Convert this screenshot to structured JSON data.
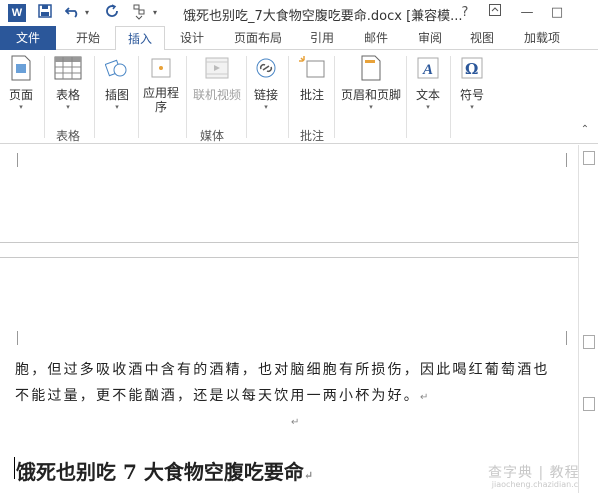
{
  "title_bar": {
    "app_icon": "W",
    "title": "饿死也别吃_7大食物空腹吃要命.docx [兼容模...",
    "help": "?",
    "ribbon_display": "⊡",
    "minimize": "—",
    "maximize": "□"
  },
  "quick_access": {
    "save_icon": "save-icon",
    "undo_icon": "undo-icon",
    "redo_icon": "redo-icon",
    "customize_icon": "customize-icon"
  },
  "tabs": [
    {
      "label": "文件"
    },
    {
      "label": "开始"
    },
    {
      "label": "插入",
      "active": true
    },
    {
      "label": "设计"
    },
    {
      "label": "页面布局"
    },
    {
      "label": "引用"
    },
    {
      "label": "邮件"
    },
    {
      "label": "审阅"
    },
    {
      "label": "视图"
    },
    {
      "label": "加载项"
    }
  ],
  "ribbon": {
    "buttons": [
      {
        "label": "页面",
        "icon": "pages-icon",
        "dropdown": true
      },
      {
        "label": "表格",
        "icon": "table-icon",
        "dropdown": true
      },
      {
        "label": "插图",
        "icon": "illustrations-icon",
        "dropdown": true
      },
      {
        "label": "应用程",
        "label2": "序",
        "icon": "apps-icon",
        "dropdown": true
      },
      {
        "label": "联机视频",
        "icon": "online-video-icon",
        "disabled": true
      },
      {
        "label": "链接",
        "icon": "link-icon",
        "dropdown": true
      },
      {
        "label": "批注",
        "icon": "comment-icon"
      },
      {
        "label": "页眉和页脚",
        "icon": "header-footer-icon",
        "dropdown": true
      },
      {
        "label": "文本",
        "icon": "text-icon",
        "dropdown": true
      },
      {
        "label": "符号",
        "icon": "symbol-icon",
        "dropdown": true
      }
    ],
    "groups": [
      "表格",
      "媒体",
      "批注"
    ]
  },
  "document": {
    "line1": "胞，但过多吸收酒中含有的酒精，也对脑细胞有所损伤，因此喝红葡萄酒也",
    "line2": "不能过量，更不能酗酒，还是以每天饮用一两小杯为好。",
    "para_mark": "↵",
    "heading": "饿死也别吃 7 大食物空腹吃要命"
  },
  "watermark": {
    "line1": "查字典 | 教程网",
    "line2": "jiaocheng.chazidian.com"
  },
  "colors": {
    "accent": "#2b579a",
    "text": "#222222"
  }
}
